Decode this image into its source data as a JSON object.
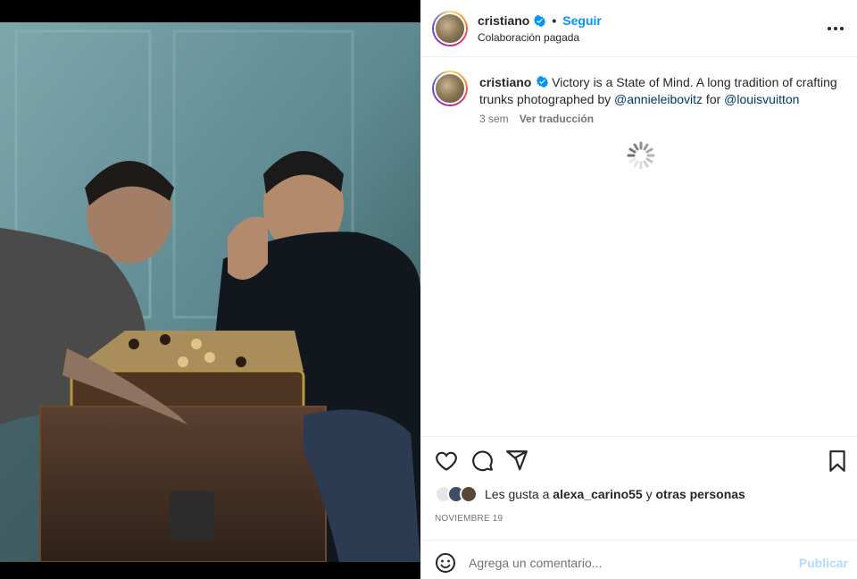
{
  "post": {
    "username": "cristiano",
    "follow_label": "Seguir",
    "separator": "•",
    "subtitle": "Colaboración pagada",
    "caption_text_1": "Victory is a State of Mind. A long tradition of crafting trunks photographed by ",
    "mention_1": "@annieleibovitz",
    "caption_join": " for ",
    "mention_2": "@louisvuitton",
    "time_ago": "3 sem",
    "translate_label": "Ver traducción",
    "likes_prefix": "Les gusta a ",
    "likes_user": "alexa_carino55",
    "likes_join": " y ",
    "likes_others": "otras personas",
    "date": "NOVIEMBRE 19",
    "comment_placeholder": "Agrega un comentario...",
    "publish_label": "Publicar"
  },
  "colors": {
    "accent": "#0095f6",
    "verified": "#0095f6",
    "publish_disabled": "#b3dbff",
    "mention": "#00376b"
  },
  "icons": {
    "like": "heart-icon",
    "comment": "comment-icon",
    "share": "share-icon",
    "save": "bookmark-icon",
    "more": "more-icon",
    "emoji": "emoji-icon"
  }
}
